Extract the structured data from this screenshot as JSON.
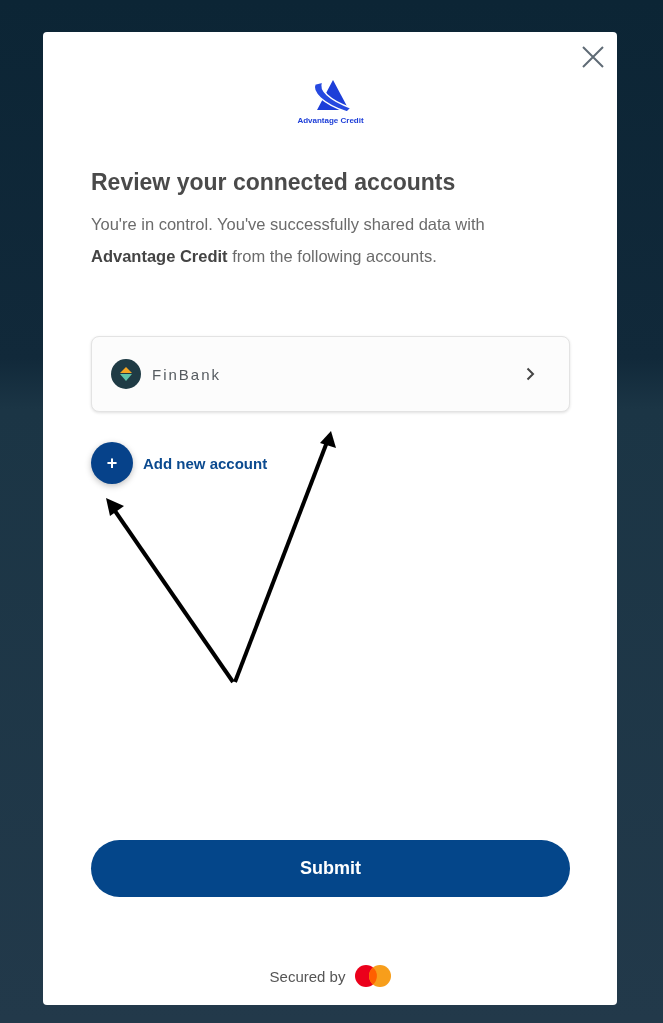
{
  "logo": {
    "text": "Advantage Credit"
  },
  "title": "Review your connected accounts",
  "intro": "You're in control. You've successfully shared data with **Advantage Credit** from the following accounts.",
  "accounts": [
    {
      "name": "FinBank"
    }
  ],
  "add_account": {
    "icon": "+",
    "label": "Add new account"
  },
  "submit": "Submit",
  "footer": {
    "text": "Secured by"
  }
}
